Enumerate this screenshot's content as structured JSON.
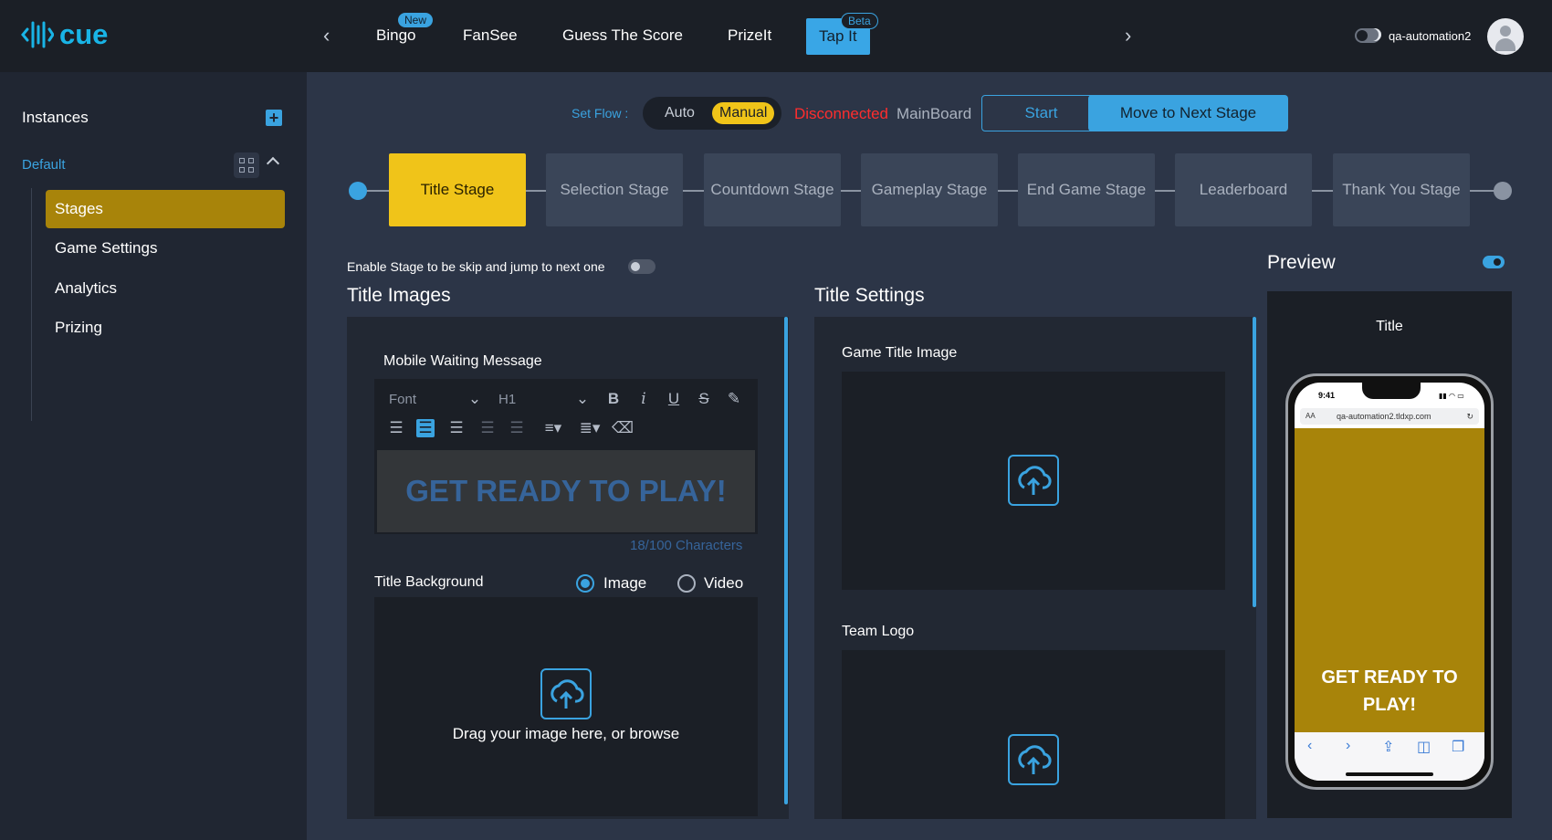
{
  "brand": {
    "name": "cue",
    "color": "#19b4e6"
  },
  "nav": {
    "tabs": [
      {
        "label": "Bingo",
        "badge": "New"
      },
      {
        "label": "FanSee"
      },
      {
        "label": "Guess The Score"
      },
      {
        "label": "PrizeIt"
      },
      {
        "label": "Tap It",
        "badge": "Beta",
        "active": true
      }
    ]
  },
  "user": {
    "name": "qa-automation2"
  },
  "sidebar": {
    "title": "Instances",
    "group": "Default",
    "items": [
      {
        "label": "Stages",
        "active": true
      },
      {
        "label": "Game Settings"
      },
      {
        "label": "Analytics"
      },
      {
        "label": "Prizing"
      }
    ]
  },
  "flow": {
    "label": "Set Flow :",
    "options": [
      "Auto",
      "Manual"
    ],
    "selected": "Manual",
    "status": "Disconnected",
    "board": "MainBoard",
    "start_label": "Start",
    "next_label": "Move to Next Stage"
  },
  "stages": [
    "Title Stage",
    "Selection Stage",
    "Countdown Stage",
    "Gameplay Stage",
    "End Game Stage",
    "Leaderboard",
    "Thank You Stage"
  ],
  "skip_label": "Enable Stage to be skip and jump to next one",
  "title_images": {
    "heading": "Title Images",
    "mobile_label": "Mobile Waiting Message",
    "font_placeholder": "Font",
    "heading_placeholder": "H1",
    "message": "GET READY TO PLAY!",
    "char_count": "18/100 Characters",
    "background_label": "Title Background",
    "media_options": [
      "Image",
      "Video"
    ],
    "media_selected": "Image",
    "drop_text": "Drag your image here, or browse"
  },
  "title_settings": {
    "heading": "Title Settings",
    "game_title_label": "Game Title Image",
    "team_logo_label": "Team Logo"
  },
  "preview": {
    "heading": "Preview",
    "screen_name": "Title",
    "time": "9:41",
    "aa": "AA",
    "url": "qa-automation2.tldxp.com",
    "message": "GET READY TO PLAY!"
  },
  "colors": {
    "accent": "#3aa3e0",
    "stage_active": "#f0c419",
    "sidebar_active": "#a8840a",
    "error": "#ff2d2d"
  }
}
